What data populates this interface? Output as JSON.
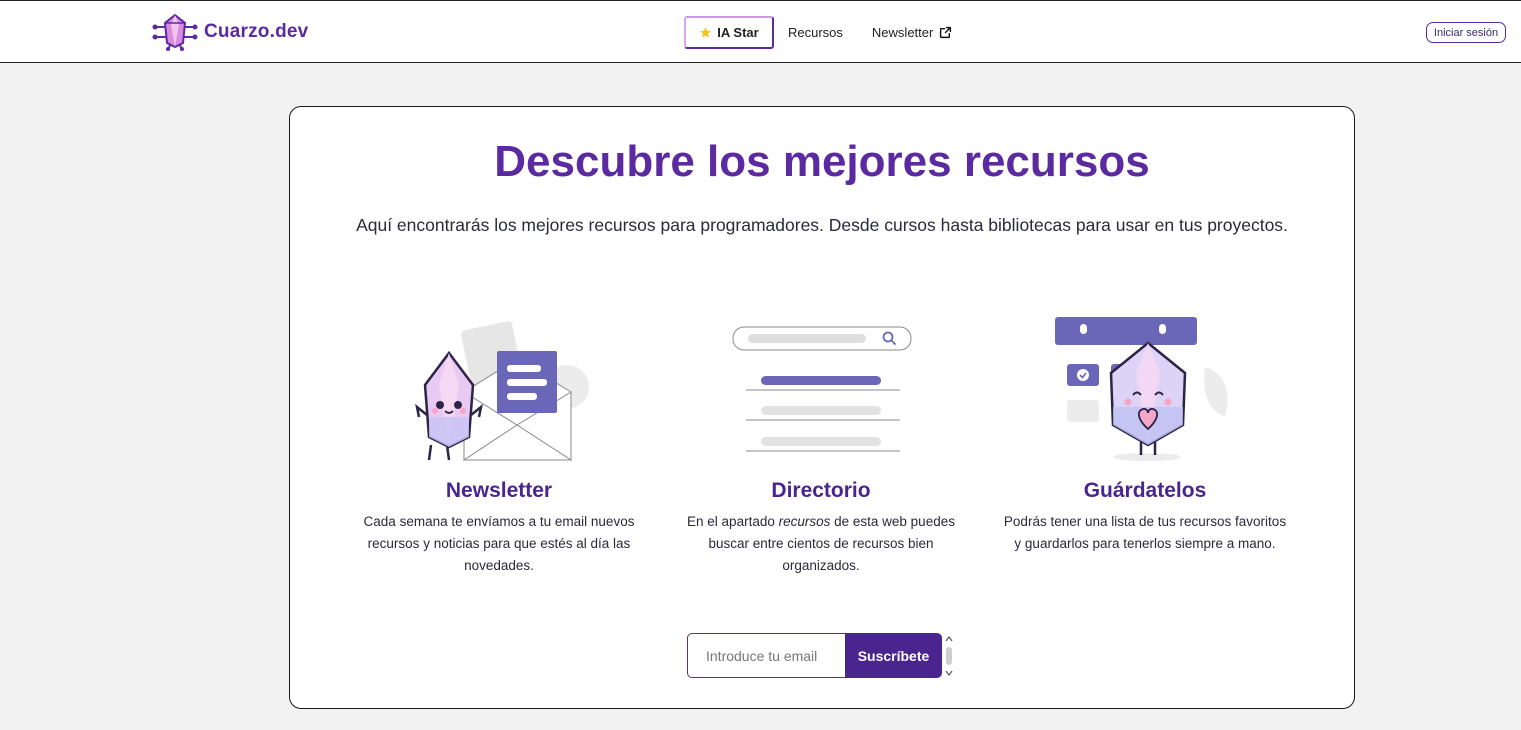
{
  "header": {
    "logo_text": "Cuarzo.dev",
    "nav": {
      "ia_star": "IA Star",
      "recursos": "Recursos",
      "newsletter": "Newsletter"
    },
    "login_label": "Iniciar sesión"
  },
  "hero": {
    "title": "Descubre los mejores recursos",
    "subtitle": "Aquí encontrarás los mejores recursos para programadores. Desde cursos hasta bibliotecas para usar en tus proyectos."
  },
  "features": [
    {
      "title": "Newsletter",
      "text": "Cada semana te envíamos a tu email nuevos recursos y noticias para que estés al día las novedades."
    },
    {
      "title": "Directorio",
      "text_before": "En el apartado ",
      "text_em": "recursos",
      "text_after": " de esta web puedes buscar entre cientos de recursos bien organizados."
    },
    {
      "title": "Guárdatelos",
      "text": "Podrás tener una lista de tus recursos favoritos y guardarlos para tenerlos siempre a mano."
    }
  ],
  "subscribe": {
    "placeholder": "Introduce tu email",
    "button": "Suscríbete"
  },
  "colors": {
    "brand": "#5b2aa0",
    "brand_dark": "#4a2590",
    "accent_lavender": "#6b67b8",
    "background": "#f2f2f2"
  },
  "icons": [
    "crystal-logo-icon",
    "star-icon",
    "external-link-icon",
    "search-icon"
  ]
}
